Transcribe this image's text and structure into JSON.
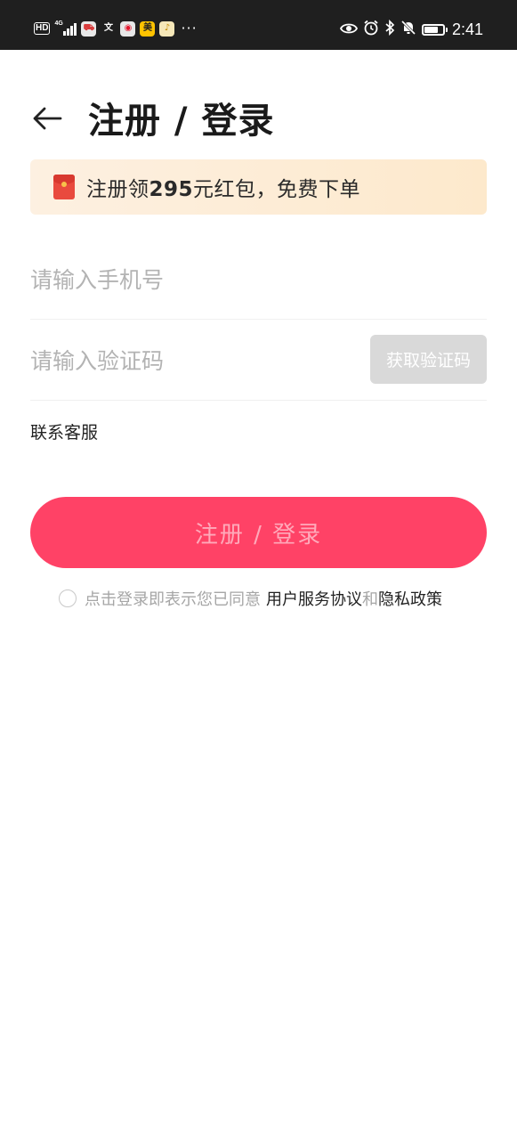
{
  "status_bar": {
    "hd_label": "HD",
    "network_label": "4G",
    "time": "2:41",
    "battery_level": 0.75,
    "more_label": "···",
    "apps": [
      {
        "icon": "app-red-icon",
        "glyph": "⛟",
        "bg": "#e8e8e8",
        "color": "#d93b3b"
      },
      {
        "icon": "wen-app-icon",
        "glyph": "文",
        "bg": "transparent",
        "color": "#ffffff"
      },
      {
        "icon": "weibo-icon",
        "glyph": "◉",
        "bg": "#e8e8e8",
        "color": "#e6162d"
      },
      {
        "icon": "meituan-icon",
        "glyph": "美",
        "bg": "#ffc300",
        "color": "#222222"
      },
      {
        "icon": "app-yellow-icon",
        "glyph": "♪",
        "bg": "#f5e7b8",
        "color": "#c48a00"
      }
    ]
  },
  "header": {
    "back_icon": "arrow-left-icon",
    "title": "注册 / 登录"
  },
  "promo": {
    "icon": "red-packet-icon",
    "text_prefix": "注册领",
    "amount": "295",
    "text_suffix": "元红包，免费下单",
    "bg_start": "#fdf0e1",
    "bg_end": "#fde9cc"
  },
  "form": {
    "phone_placeholder": "请输入手机号",
    "phone_value": "",
    "code_placeholder": "请输入验证码",
    "code_value": "",
    "get_code_label": "获取验证码"
  },
  "contact_service_label": "联系客服",
  "submit_label": "注册 / 登录",
  "agreement": {
    "prefix": "点击登录即表示您已同意",
    "user_agreement": "用户服务协议",
    "joiner": "和",
    "privacy_policy": "隐私政策",
    "checked": false
  },
  "colors": {
    "accent": "#ff4266",
    "disabled_button": "#d9d9d9",
    "placeholder": "#b3b3b3"
  }
}
